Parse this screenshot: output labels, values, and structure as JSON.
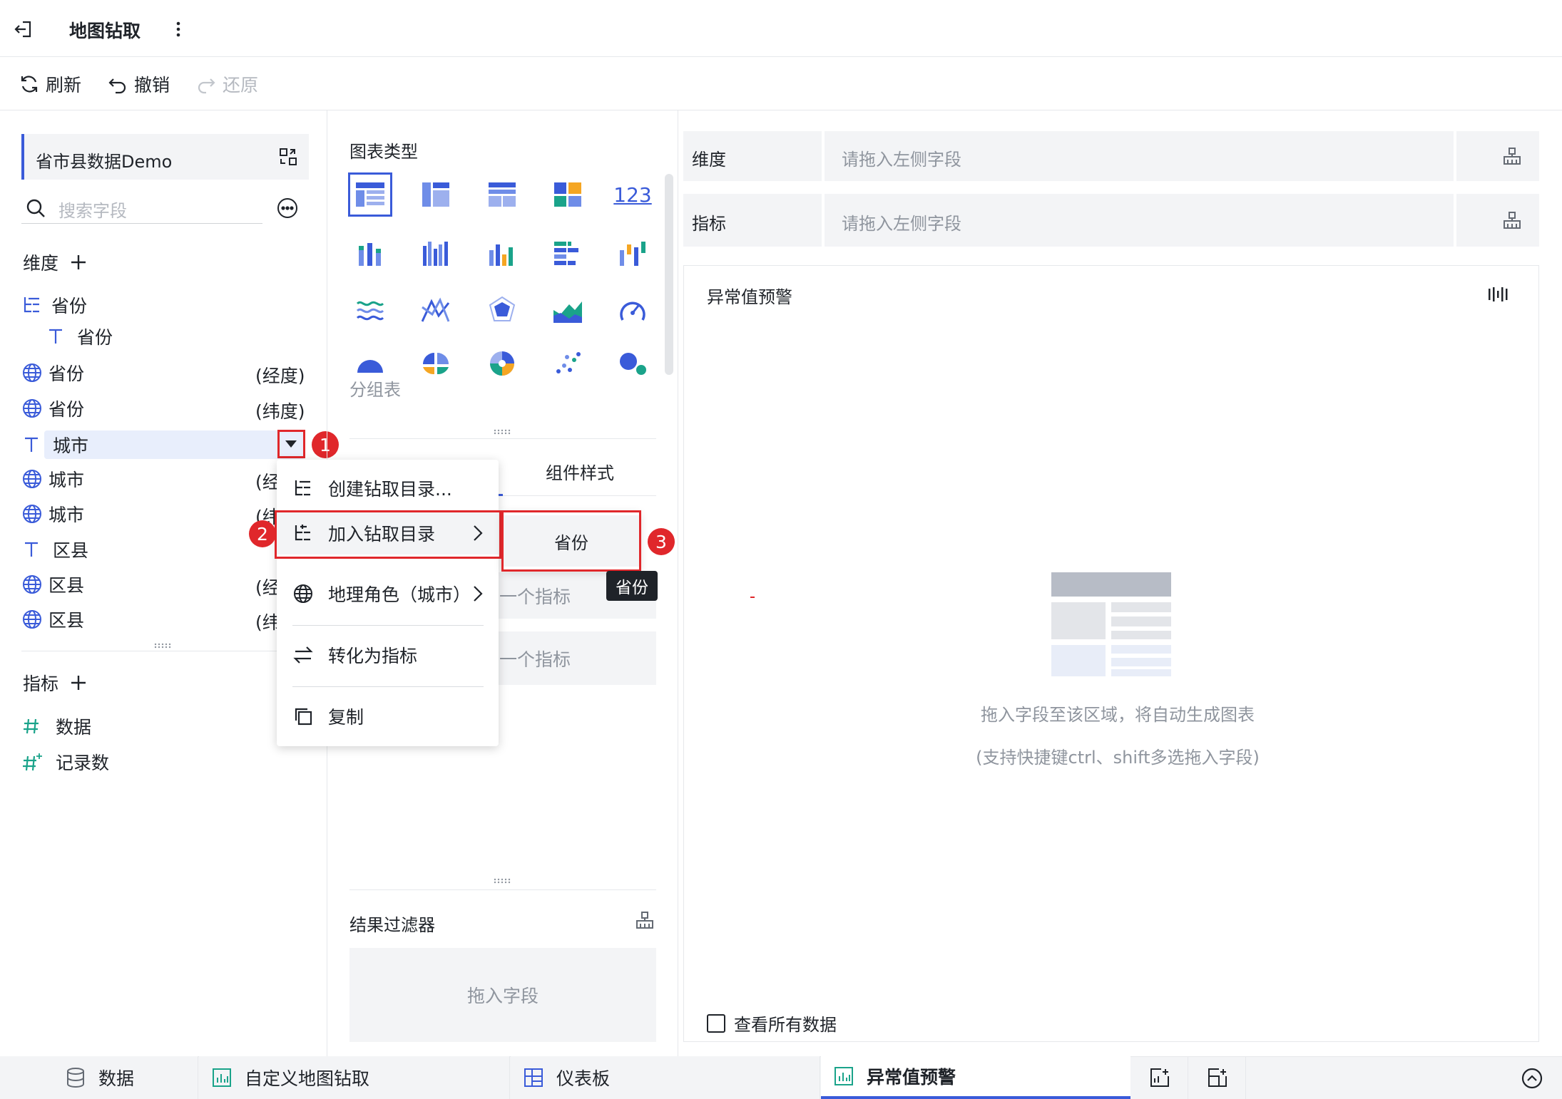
{
  "header": {
    "title": "地图钻取",
    "more_icon": "vertical-ellipsis-icon"
  },
  "toolbar": {
    "refresh": "刷新",
    "undo": "撤销",
    "redo": "还原"
  },
  "left_panel": {
    "dataset_name": "省市县数据Demo",
    "search_placeholder": "搜索字段",
    "dimensions_title": "维度",
    "dimension_fields": [
      {
        "icon": "hierarchy-icon",
        "label": "省份",
        "suffix": ""
      },
      {
        "icon": "text-icon",
        "label": "省份",
        "suffix": ""
      },
      {
        "icon": "globe-icon",
        "label": "省份",
        "suffix": "(经度)"
      },
      {
        "icon": "globe-icon",
        "label": "省份",
        "suffix": "(纬度)"
      },
      {
        "icon": "text-icon",
        "label": "城市",
        "suffix": ""
      },
      {
        "icon": "globe-icon",
        "label": "城市",
        "suffix": "(经"
      },
      {
        "icon": "globe-icon",
        "label": "城市",
        "suffix": "(纬"
      },
      {
        "icon": "text-icon",
        "label": "区县",
        "suffix": ""
      },
      {
        "icon": "globe-icon",
        "label": "区县",
        "suffix": "(经"
      },
      {
        "icon": "globe-icon",
        "label": "区县",
        "suffix": "(纬"
      }
    ],
    "measures_title": "指标",
    "measure_fields": [
      {
        "icon": "hash-icon",
        "label": "数据"
      },
      {
        "icon": "hash-star-icon",
        "label": "记录数"
      }
    ]
  },
  "context_menu": {
    "items": [
      "创建钻取目录...",
      "加入钻取目录",
      "地理角色（城市）",
      "转化为指标",
      "复制"
    ],
    "submenu_item": "省份",
    "tooltip": "省份"
  },
  "annotations": {
    "badge1": "1",
    "badge2": "2",
    "badge3": "3"
  },
  "middle_panel": {
    "chart_type_title": "图表类型",
    "chart_hover_label": "分组表",
    "style_tab": "组件样式",
    "measure_slot_1": "一个指标",
    "measure_slot_2": "一个指标",
    "filter_title": "结果过滤器",
    "filter_placeholder": "拖入字段"
  },
  "right_panel": {
    "dimension_label": "维度",
    "dimension_placeholder": "请拖入左侧字段",
    "measure_label": "指标",
    "measure_placeholder": "请拖入左侧字段",
    "chart_title": "异常值预警",
    "empty_hint": "拖入字段至该区域，将自动生成图表",
    "empty_subhint": "(支持快捷键ctrl、shift多选拖入字段)",
    "show_all_data": "查看所有数据"
  },
  "bottom_tabs": [
    {
      "label": "数据",
      "icon": "database-icon",
      "active": false
    },
    {
      "label": "自定义地图钻取",
      "icon": "bar-chart-icon",
      "active": false
    },
    {
      "label": "仪表板",
      "icon": "dashboard-icon",
      "active": false
    },
    {
      "label": "异常值预警",
      "icon": "bar-chart-icon",
      "active": true
    }
  ],
  "colors": {
    "accent": "#3a5bd9",
    "annotation_red": "#e0272b",
    "panel_bg": "#f3f4f6"
  }
}
